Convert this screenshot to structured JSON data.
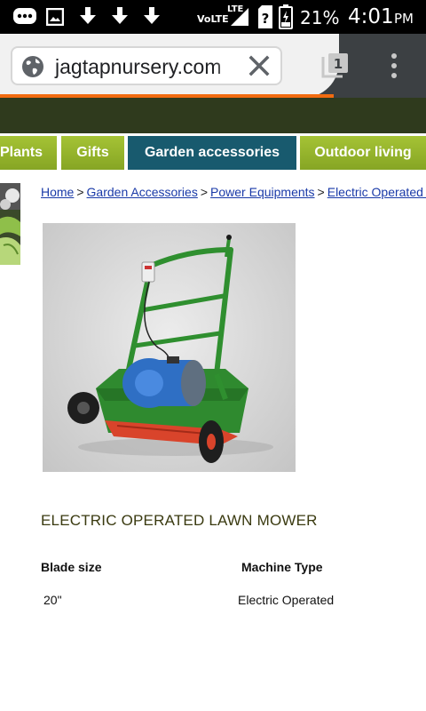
{
  "status_bar": {
    "network_label": "VoLTE",
    "lte_label": "LTE",
    "battery_percent": "21%",
    "time": "4:01",
    "ampm": "PM",
    "icons": [
      "messenger-icon",
      "image-icon",
      "download-icon",
      "download-icon",
      "download-icon",
      "signal-icon",
      "sim-unknown-icon",
      "battery-icon"
    ]
  },
  "browser": {
    "url": "jagtapnursery.com",
    "tab_count": "1",
    "icons": [
      "globe-icon",
      "close-icon",
      "tab-switcher-icon",
      "menu-icon"
    ],
    "progress_color": "#f26b10"
  },
  "nav": {
    "items": [
      {
        "label": "Plants",
        "active": false
      },
      {
        "label": "Gifts",
        "active": false
      },
      {
        "label": "Garden accessories",
        "active": true
      },
      {
        "label": "Outdoor living",
        "active": false
      }
    ],
    "green_color": "#95b52c",
    "active_color": "#185a6e"
  },
  "breadcrumb": {
    "items": [
      "Home",
      "Garden Accessories",
      "Power Equipments",
      "Electric Operated Lawn Mower"
    ],
    "separator": ">"
  },
  "product": {
    "title": "ELECTRIC OPERATED LAWN MOWER",
    "specs": {
      "headers": [
        "Blade size",
        "Machine Type"
      ],
      "values": [
        "20\"",
        "Electric Operated"
      ]
    }
  }
}
